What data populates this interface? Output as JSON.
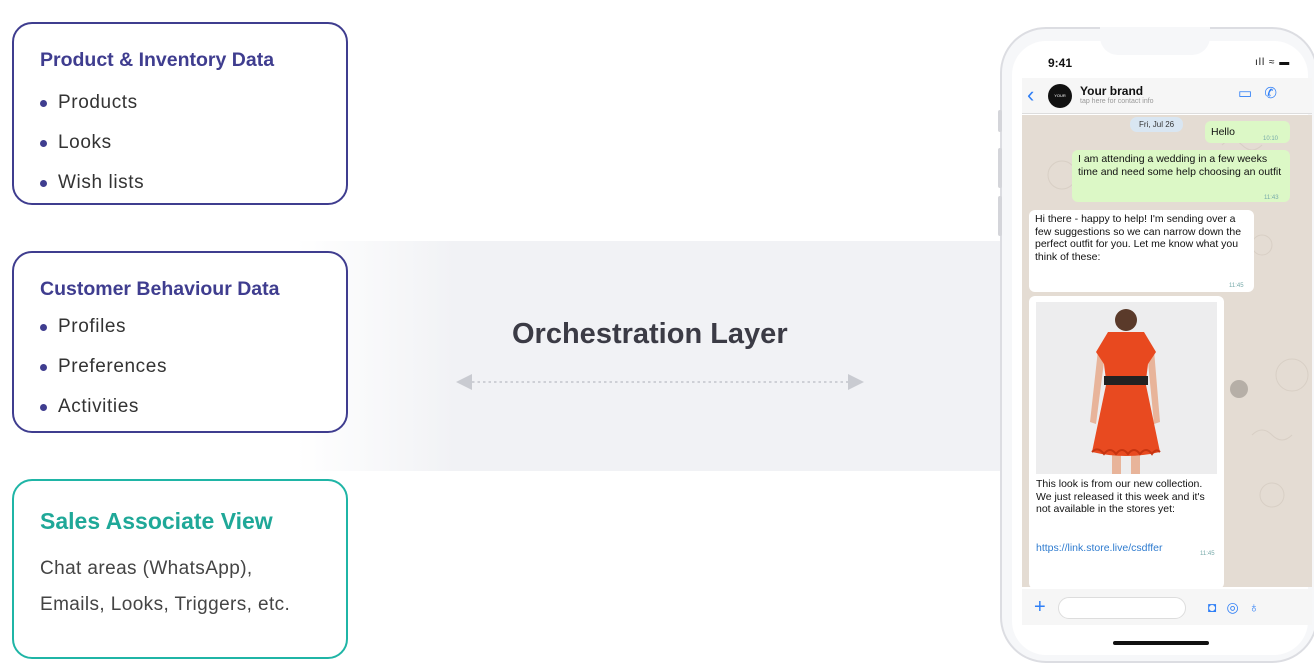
{
  "cards": [
    {
      "title": "Product & Inventory Data",
      "items": [
        "Products",
        "Looks",
        "Wish lists"
      ]
    },
    {
      "title": "Customer Behaviour Data",
      "items": [
        "Profiles",
        "Preferences",
        "Activities"
      ]
    },
    {
      "title": "Sales Associate View",
      "lines": [
        "Chat areas (WhatsApp),",
        "Emails, Looks, Triggers, etc."
      ]
    }
  ],
  "center": {
    "label": "Orchestration Layer"
  },
  "phone": {
    "time": "9:41",
    "status_icons": "ıll ≈ ▬",
    "contact_name": "Your brand",
    "contact_sub": "tap here for contact info",
    "avatar_text": "YOUR BRAND",
    "date": "Fri, Jul 26",
    "messages": {
      "hello": "Hello",
      "hello_time": "10:10",
      "wedding": "I am attending a wedding in a few weeks time and need some help choosing an outfit",
      "wedding_time": "11:43",
      "reply": "Hi there - happy to help! I'm sending over a few suggestions so we can narrow down the perfect outfit for you. Let me know what you think of these:",
      "reply_time": "11:45",
      "caption": "This look is from our new collection. We just released it this week and it's not available in the stores yet:",
      "link": "https://link.store.live/csdffer",
      "link_time": "11:45"
    }
  },
  "colors": {
    "primary": "#3f3d8f",
    "accent": "#1fb5a6",
    "chat_bg": "#e4dcd3",
    "bubble_out": "#dcf8c6",
    "link": "#2e7bcf"
  }
}
